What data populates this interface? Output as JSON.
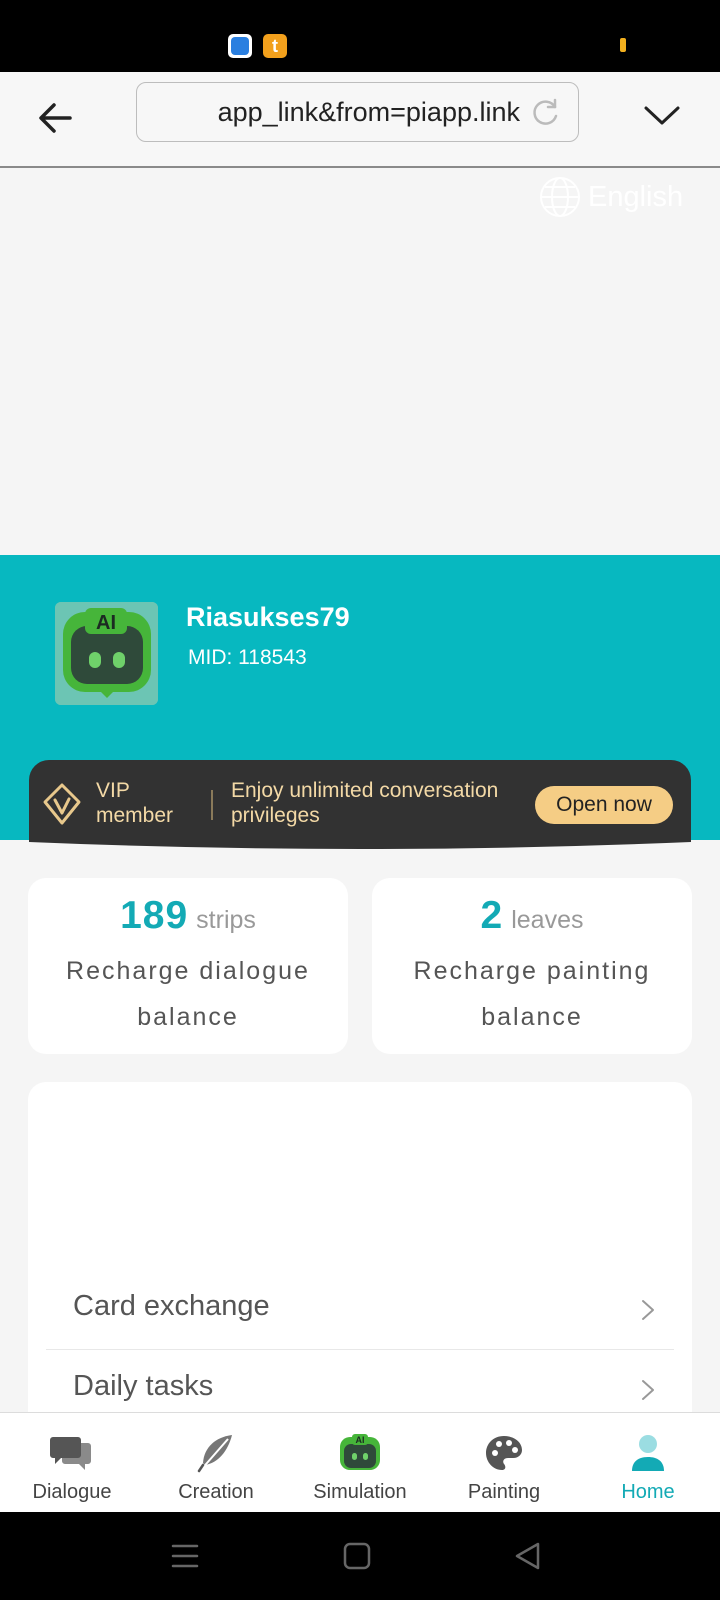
{
  "status_bar": {
    "app_icons": [
      "browser-app-icon",
      "t-app-icon"
    ],
    "app2_glyph": "t"
  },
  "browser": {
    "url": "app_link&from=piapp.link"
  },
  "language": "English",
  "profile": {
    "avatar_text": "AI",
    "username": "Riasukses79",
    "mid": "MID: 118543"
  },
  "vip": {
    "label": "VIP member",
    "description": "Enjoy unlimited conversation privileges",
    "button": "Open now"
  },
  "balances": [
    {
      "value": "189",
      "unit": "strips",
      "label": "Recharge dialogue balance"
    },
    {
      "value": "2",
      "unit": "leaves",
      "label": "Recharge painting balance"
    }
  ],
  "menu": [
    {
      "label": "Card exchange"
    },
    {
      "label": "Daily tasks"
    }
  ],
  "bottom_nav": [
    {
      "label": "Dialogue",
      "icon": "chat-bubbles-icon"
    },
    {
      "label": "Creation",
      "icon": "feather-icon"
    },
    {
      "label": "Simulation",
      "icon": "robot-icon"
    },
    {
      "label": "Painting",
      "icon": "palette-icon"
    },
    {
      "label": "Home",
      "icon": "person-icon",
      "active": true
    }
  ],
  "colors": {
    "accent": "#13aab5",
    "hero_bg": "#07b8c0",
    "vip_bg": "#323232",
    "vip_text": "#f3d9a6",
    "vip_button": "#f5cd85"
  }
}
